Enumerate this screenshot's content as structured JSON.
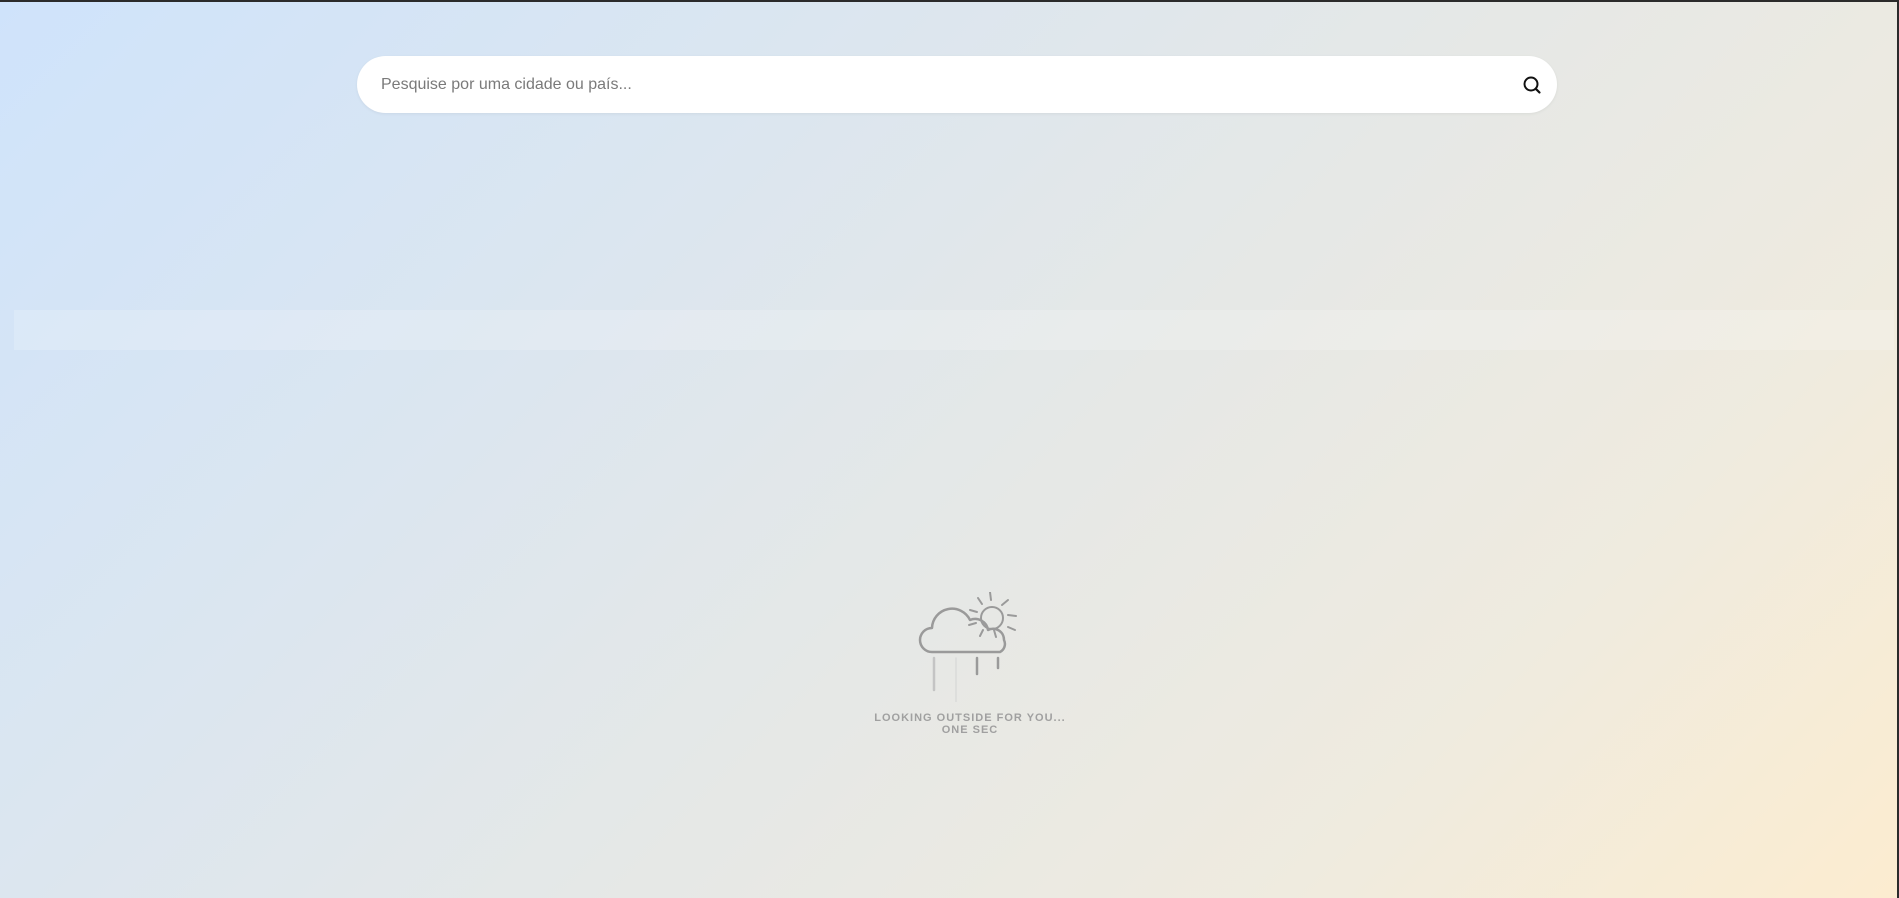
{
  "search": {
    "placeholder": "Pesquise por uma cidade ou país...",
    "value": "",
    "icon": "search-icon"
  },
  "loader": {
    "icon": "cloud-sun-rain-icon",
    "line1": "LOOKING OUTSIDE FOR YOU...",
    "line2": "ONE SEC"
  },
  "colors": {
    "gradient_start": "#cfe3fb",
    "gradient_end": "#fcecd0",
    "loader_text": "#a0a0a0",
    "icon_stroke": "#9a9a9a"
  }
}
